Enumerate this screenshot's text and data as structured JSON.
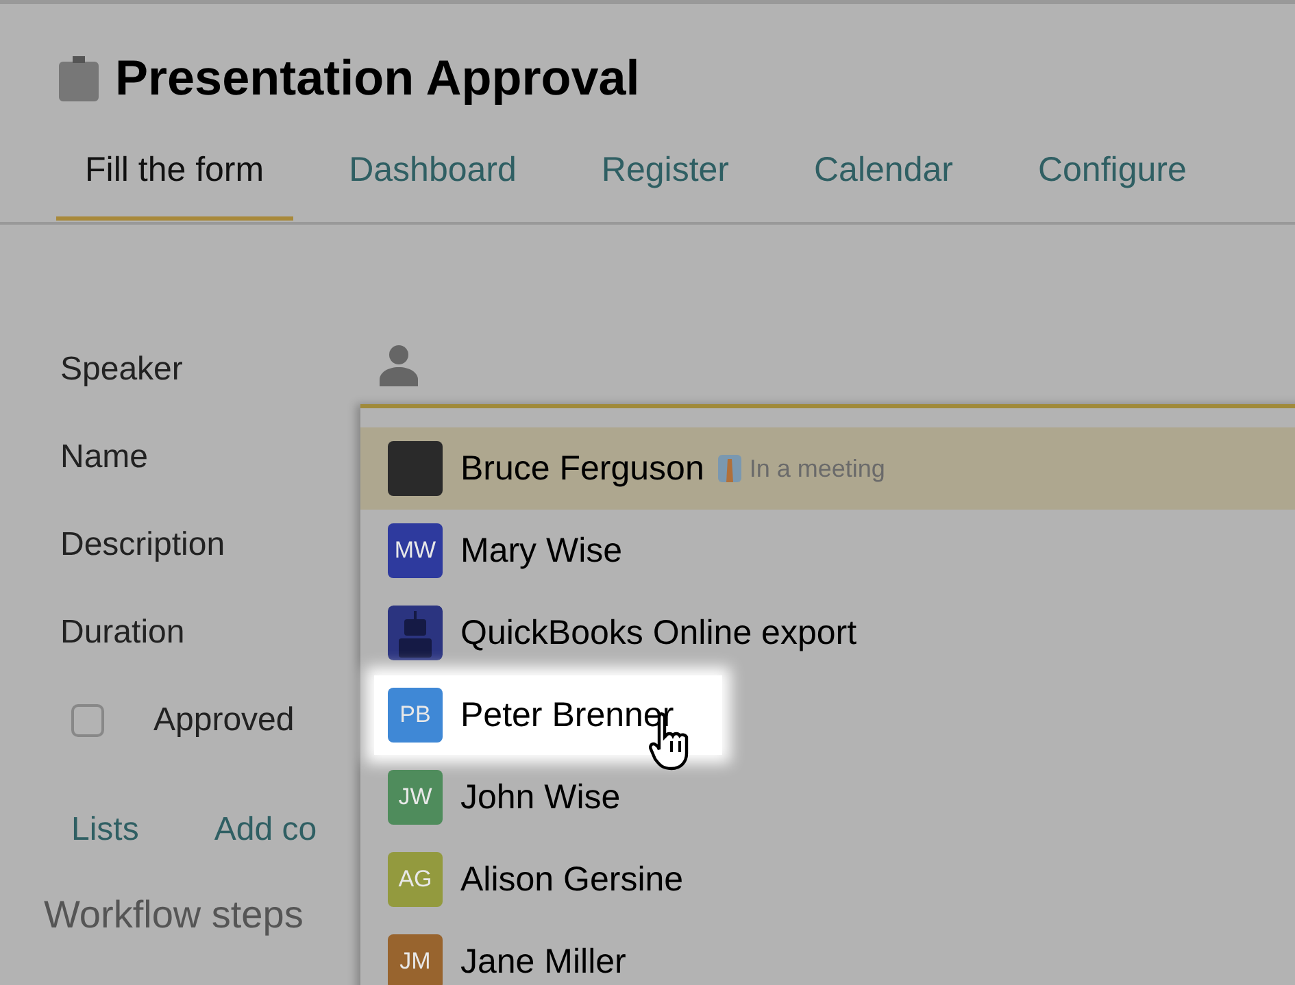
{
  "title": "Presentation Approval",
  "tabs": [
    {
      "label": "Fill the form",
      "selected": true
    },
    {
      "label": "Dashboard",
      "selected": false
    },
    {
      "label": "Register",
      "selected": false
    },
    {
      "label": "Calendar",
      "selected": false
    },
    {
      "label": "Configure",
      "selected": false
    }
  ],
  "form": {
    "fields": [
      {
        "label": "Speaker",
        "kind": "person"
      },
      {
        "label": "Name",
        "kind": "text"
      },
      {
        "label": "Description",
        "kind": "text"
      },
      {
        "label": "Duration",
        "kind": "text"
      }
    ],
    "checkbox": {
      "label": "Approved",
      "checked": false
    },
    "links": [
      "Lists",
      "Add co"
    ],
    "section": "Workflow steps"
  },
  "dropdown": {
    "items": [
      {
        "name": "Bruce Ferguson",
        "kind": "photo",
        "status": "In a meeting",
        "selected": true,
        "hovered": false
      },
      {
        "name": "Mary Wise",
        "kind": "initials",
        "initials": "MW",
        "color": "#2e3a9e",
        "selected": false,
        "hovered": false
      },
      {
        "name": "QuickBooks Online export",
        "kind": "bot",
        "color": "#2b3480",
        "selected": false,
        "hovered": false
      },
      {
        "name": "Peter Brenner",
        "kind": "initials",
        "initials": "PB",
        "color": "#3f88d6",
        "selected": false,
        "hovered": true
      },
      {
        "name": "John Wise",
        "kind": "initials",
        "initials": "JW",
        "color": "#4f8c5c",
        "selected": false,
        "hovered": false
      },
      {
        "name": "Alison Gersine",
        "kind": "initials",
        "initials": "AG",
        "color": "#939a3e",
        "selected": false,
        "hovered": false
      },
      {
        "name": "Jane Miller",
        "kind": "initials",
        "initials": "JM",
        "color": "#98642e",
        "selected": false,
        "hovered": false
      }
    ]
  }
}
